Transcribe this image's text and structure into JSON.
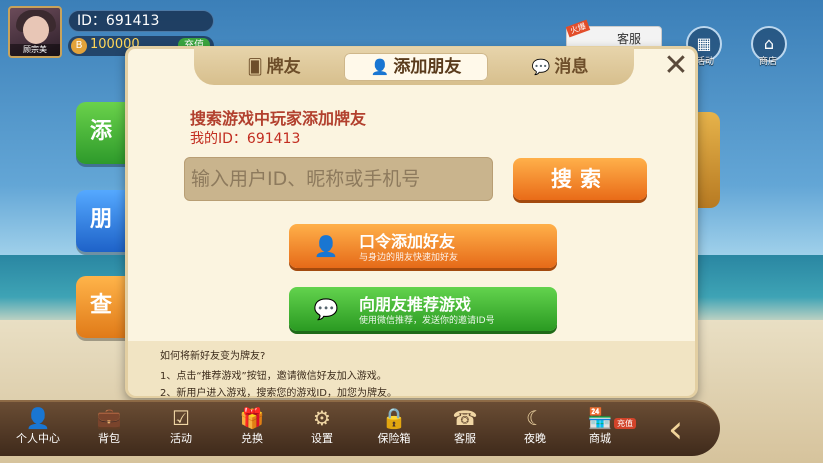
{
  "profile": {
    "nickname": "顾宗美",
    "id_text": "ID：691413",
    "coins": "100000",
    "coin_icon": "B",
    "recharge_label": "充值"
  },
  "top_right": {
    "service_label": "客服",
    "service_hot_label": "火爆",
    "activity_label": "活动",
    "shop_label": "商店"
  },
  "side_buttons": [
    {
      "label": "添"
    },
    {
      "label": "朋"
    },
    {
      "label": "查"
    }
  ],
  "modal": {
    "tabs": [
      {
        "label": "牌友",
        "icon": "cards-icon"
      },
      {
        "label": "添加朋友",
        "icon": "add-user-icon"
      },
      {
        "label": "消息",
        "icon": "chat-icon"
      }
    ],
    "close_label": "✕",
    "title": "搜索游戏中玩家添加牌友",
    "my_id": "我的ID：691413",
    "search_placeholder": "输入用户ID、昵称或手机号",
    "search_button": "搜索",
    "command_add": {
      "title": "口令添加好友",
      "subtitle": "与身边的朋友快速加好友"
    },
    "recommend": {
      "title": "向朋友推荐游戏",
      "subtitle": "使用微信推荐，发送你的邀请ID号"
    },
    "tips": {
      "question": "如何将新好友变为牌友?",
      "step1": "1、点击“推荐游戏”按钮，邀请微信好友加入游戏。",
      "step2": "2、新用户进入游戏，搜索您的游戏ID，加您为牌友。"
    }
  },
  "bottom_nav": [
    {
      "label": "个人中心",
      "icon": "person-icon"
    },
    {
      "label": "背包",
      "icon": "bag-icon"
    },
    {
      "label": "活动",
      "icon": "activity-icon"
    },
    {
      "label": "兑换",
      "icon": "gift-icon"
    },
    {
      "label": "设置",
      "icon": "gear-icon"
    },
    {
      "label": "保险箱",
      "icon": "safe-icon"
    },
    {
      "label": "客服",
      "icon": "headset-icon"
    },
    {
      "label": "夜晚",
      "icon": "moon-icon"
    },
    {
      "label": "商城",
      "icon": "shop-icon"
    }
  ],
  "bottom_recharge_badge": "充值"
}
